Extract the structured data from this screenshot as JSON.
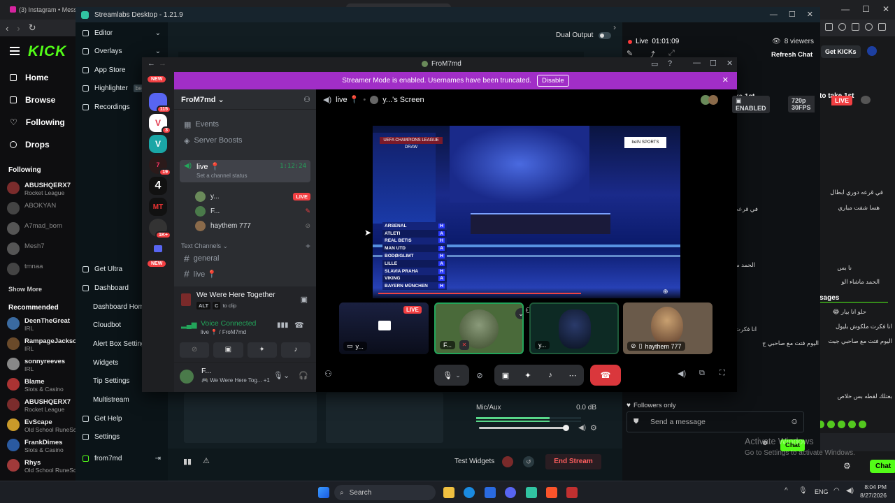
{
  "browser": {
    "tabs": [
      "(3) Instagram • Messages",
      "",
      "",
      ""
    ],
    "address": ""
  },
  "kick": {
    "logo": "KICK",
    "nav": [
      "Home",
      "Browse",
      "Following",
      "Drops"
    ],
    "following_header": "Following",
    "following": [
      {
        "name": "ABUSHQERX7",
        "category": "Rocket League",
        "color": "#7b2c2c"
      },
      {
        "name": "ABOKYAN",
        "category": "",
        "color": "#444"
      },
      {
        "name": "A7mad_bom",
        "category": "",
        "color": "#555"
      },
      {
        "name": "Mesh7",
        "category": "",
        "color": "#555"
      },
      {
        "name": "tmnaa",
        "category": "",
        "color": "#444"
      }
    ],
    "show_more": "Show More",
    "recommended_header": "Recommended",
    "recommended": [
      {
        "name": "DeenTheGreat",
        "category": "IRL",
        "color": "#3a6aa0"
      },
      {
        "name": "RampageJackson",
        "category": "IRL",
        "color": "#6a4a2a"
      },
      {
        "name": "sonnyreeves",
        "category": "IRL",
        "color": "#888"
      },
      {
        "name": "Blame",
        "category": "Slots & Casino",
        "color": "#a33"
      },
      {
        "name": "ABUSHQERX7",
        "category": "Rocket League",
        "color": "#7b2c2c"
      },
      {
        "name": "EvScape",
        "category": "Old School RuneScape",
        "color": "#c99a2a"
      },
      {
        "name": "FrankDimes",
        "category": "Slots & Casino",
        "color": "#2a5aa0"
      },
      {
        "name": "Rhys",
        "category": "Old School RuneScape",
        "color": "#a03a3a"
      }
    ],
    "get_kicks": "Get KICKs",
    "right_chat": {
      "take_1st": "to take 1st",
      "lines": [
        "في قرعه دوري ابطال",
        "هسا شفت مباري",
        "نا بس",
        "الحمد ماشاء الو",
        "اليوم فتت مع صاحبي جبت",
        "انا فكرت ملكوش بليول",
        "بعتلك لقطه بس خلاص"
      ],
      "messages_label": "sages",
      "chat_btn": "Chat"
    }
  },
  "streamlabs": {
    "title": "Streamlabs Desktop - 1.21.9",
    "sidebar_top": [
      {
        "label": "Editor",
        "icon": "editor-icon",
        "chev": true
      },
      {
        "label": "Overlays",
        "icon": "overlays-icon",
        "chev": true
      },
      {
        "label": "App Store",
        "icon": "store-icon",
        "chev": false
      },
      {
        "label": "Highlighter",
        "icon": "highlighter-icon",
        "chev": false
      },
      {
        "label": "Recordings",
        "icon": "recordings-icon",
        "chev": false
      }
    ],
    "highlighter_badge": "beta",
    "sidebar_bottom": [
      {
        "label": "Get Ultra",
        "icon": "ultra-icon",
        "sub": false
      },
      {
        "label": "Dashboard",
        "icon": "dashboard-icon",
        "sub": false
      },
      {
        "label": "Dashboard Home",
        "icon": "",
        "sub": true
      },
      {
        "label": "Cloudbot",
        "icon": "",
        "sub": true
      },
      {
        "label": "Alert Box Settings",
        "icon": "",
        "sub": true
      },
      {
        "label": "Widgets",
        "icon": "",
        "sub": true
      },
      {
        "label": "Tip Settings",
        "icon": "",
        "sub": true
      },
      {
        "label": "Multistream",
        "icon": "",
        "sub": true
      },
      {
        "label": "Get Help",
        "icon": "help-icon",
        "sub": false
      },
      {
        "label": "Settings",
        "icon": "settings-icon",
        "sub": false
      },
      {
        "label": "from7md",
        "icon": "kick-icon",
        "sub": false
      }
    ],
    "dual_output": "Dual Output",
    "mixer": {
      "label": "Mic/Aux",
      "value": "0.0 dB"
    },
    "test_widgets": "Test Widgets",
    "end_stream": "End Stream",
    "live": {
      "status": "Live",
      "time": "01:01:09",
      "viewers": "8 viewers",
      "refresh": "Refresh Chat"
    },
    "chat": {
      "header_partial": "ke 1st",
      "followers_only": "Followers only",
      "placeholder": "Send a message",
      "chat_btn": "Chat",
      "lines": [
        "في قرعه",
        "خر",
        "لا بس ع",
        "الحمد ماشاء الو",
        "انا فكرت",
        "اليوم فتت مع صاحبي ج",
        "بعتلك"
      ]
    },
    "activate": {
      "line1": "Activate Windows",
      "line2": "Go to Settings to activate Windows."
    }
  },
  "discord": {
    "title": "FroM7md",
    "banner": {
      "text": "Streamer Mode is enabled. Usernames have been truncated.",
      "button": "Disable"
    },
    "guild_badges": [
      "NEW",
      "115",
      "3",
      "19",
      "1K+",
      "NEW"
    ],
    "server_name": "FroM7md",
    "nav": [
      "Events",
      "Server Boosts"
    ],
    "voice_channel": {
      "name": "live 📍",
      "time": "1:12:24",
      "status": "Set a channel status"
    },
    "voice_users": [
      {
        "name": "y...",
        "live": "LIVE",
        "color": "#6a8a5a"
      },
      {
        "name": "F...",
        "live": "",
        "color": "#4a7a4a"
      },
      {
        "name": "haythem 777",
        "live": "",
        "color": "#8a6a4a"
      }
    ],
    "text_channels_header": "Text Channels",
    "text_channels": [
      "general",
      "live 📍"
    ],
    "activity": {
      "title": "We Were Here Together",
      "k1": "ALT",
      "k2": "C",
      "tail": "to clip"
    },
    "voice_connected": {
      "title": "Voice Connected",
      "sub": "live 📍 / FroM7md"
    },
    "user": {
      "name": "F...",
      "status": "We Were Here Tog...",
      "extra": "+1"
    },
    "stage": {
      "channel": "live 📍",
      "screen": "y...'s Screen",
      "enabled": "ENABLED",
      "quality": "720p 30FPS",
      "live": "LIVE"
    },
    "draw": {
      "header": "UEFA CHAMPIONS LEAGUE DRAW",
      "teams": [
        "ARSENAL",
        "ATLETI",
        "REAL BETIS",
        "MAN UTD",
        "BODØ/GLIMT",
        "LILLE",
        "SLAVIA PRAHA",
        "VIKING",
        "BAYERN MÜNCHEN"
      ],
      "ha": [
        "H",
        "A",
        "H",
        "A",
        "H",
        "A",
        "H",
        "A",
        "H"
      ]
    },
    "tiles": [
      {
        "label": "y...",
        "live": "LIVE"
      },
      {
        "label": "F...",
        "live": ""
      },
      {
        "label": "y...",
        "live": ""
      },
      {
        "label": "haythem 777",
        "live": ""
      }
    ]
  },
  "taskbar": {
    "search": "Search",
    "lang": "ENG",
    "time": "8:04 PM",
    "date": "8/27/2026"
  }
}
